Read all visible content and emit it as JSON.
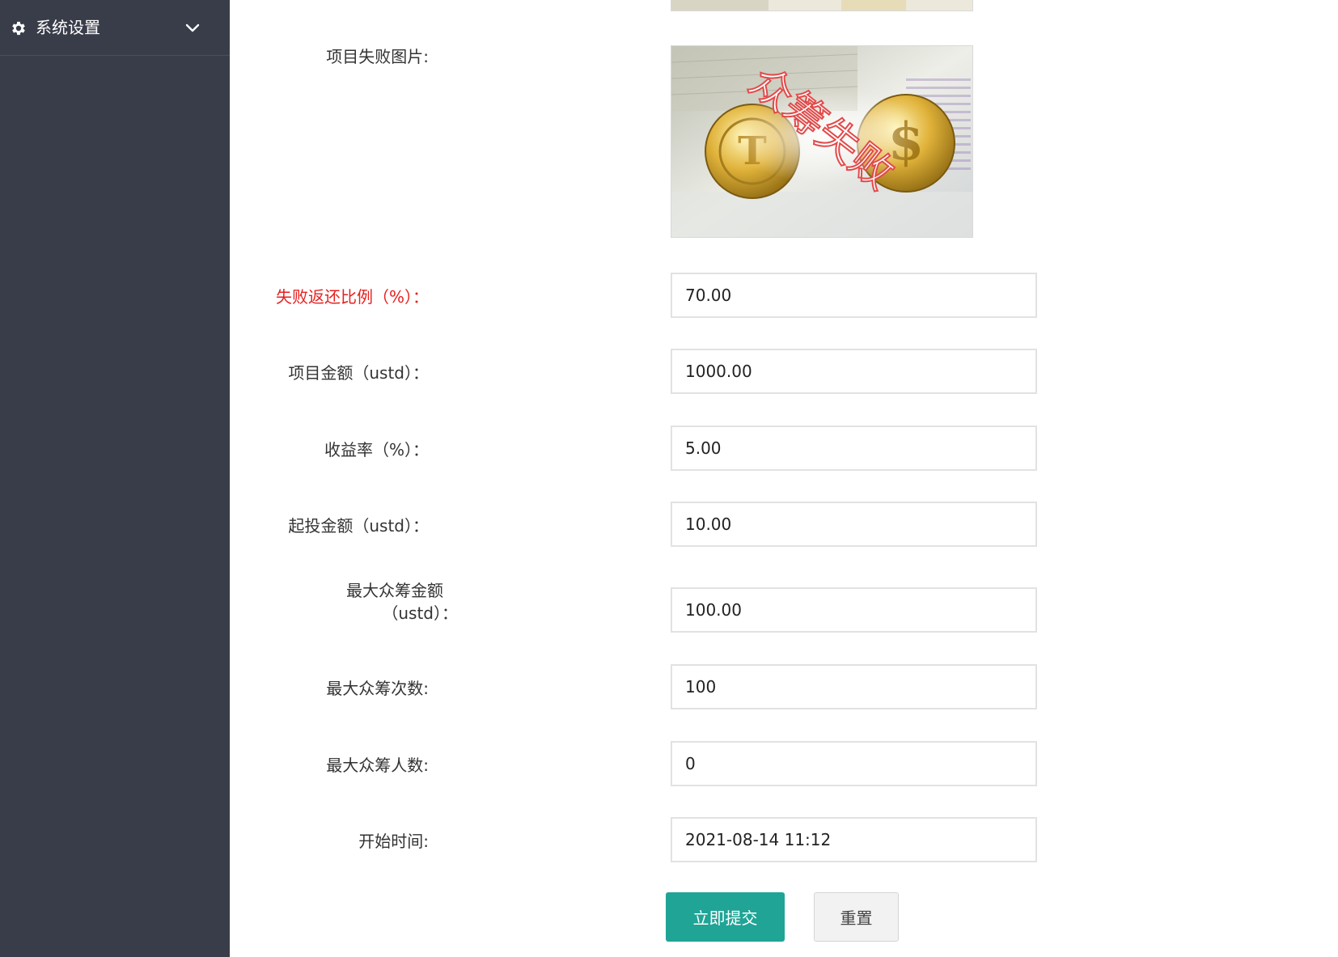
{
  "sidebar": {
    "menu_title": "系统设置",
    "menu_icon": "gear-icon",
    "toggle_icon": "chevron-down-icon"
  },
  "form": {
    "fail_image_label": "项目失败图片:",
    "fail_image_caption": "众筹失败",
    "fields": {
      "refund_ratio": {
        "label": "失败返还比例（%）：",
        "value": "70.00"
      },
      "project_amount": {
        "label": "项目金额（ustd）：",
        "value": "1000.00"
      },
      "yield_rate": {
        "label": "收益率（%）：",
        "value": "5.00"
      },
      "min_invest": {
        "label": "起投金额（ustd）：",
        "value": "10.00"
      },
      "max_crowdfund_amount": {
        "label_line1": "最大众筹金额",
        "label_line2": "（ustd）：",
        "value": "100.00"
      },
      "max_crowdfund_times": {
        "label": "最大众筹次数:",
        "value": "100"
      },
      "max_crowdfund_people": {
        "label": "最大众筹人数:",
        "value": "0"
      },
      "start_time": {
        "label": "开始时间:",
        "value": "2021-08-14 11:12"
      }
    },
    "submit_label": "立即提交",
    "reset_label": "重置"
  },
  "colors": {
    "sidebar_bg": "#393d49",
    "primary_button": "#1fa496",
    "required_label": "#e6201f"
  }
}
